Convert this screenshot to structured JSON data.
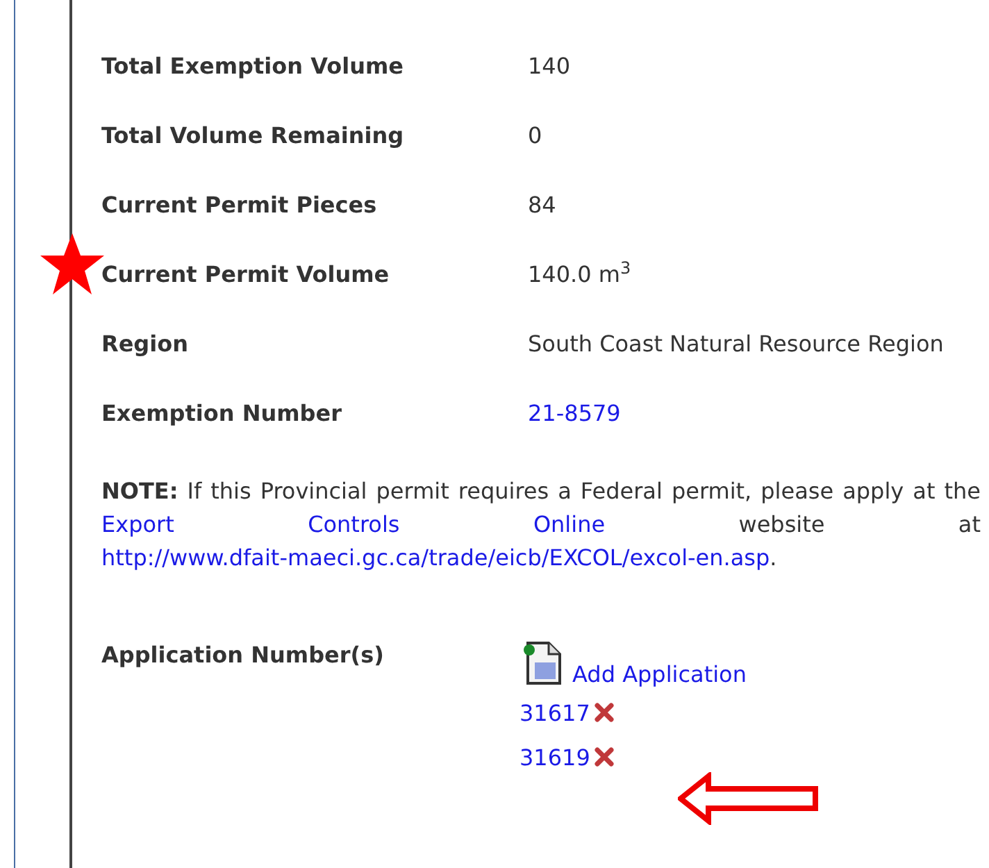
{
  "fields": [
    {
      "label": "Total Exemption Volume",
      "value": "140",
      "kind": "text"
    },
    {
      "label": "Total Volume Remaining",
      "value": "0",
      "kind": "text"
    },
    {
      "label": "Current Permit Pieces",
      "value": "84",
      "kind": "text"
    },
    {
      "label": "Current Permit Volume",
      "value": "140.0 m$^{3}$",
      "kind": "text"
    },
    {
      "label": "Region",
      "value": "South Coast Natural Resource Region",
      "kind": "text"
    },
    {
      "label": "Exemption Number",
      "value": "21-8579",
      "kind": "link"
    }
  ],
  "note": [
    {
      "kind": "bold",
      "text": "NOTE:"
    },
    {
      "kind": "text",
      "text": " If this Provincial permit requires a Federal permit, please apply at the "
    },
    {
      "kind": "link",
      "text": "Export Controls Online"
    },
    {
      "kind": "text",
      "text": " website at "
    },
    {
      "kind": "link",
      "text": "http://www.dfait-maeci.gc.ca/trade/eicb/EXCOL/excol-en.asp"
    },
    {
      "kind": "text",
      "text": "."
    }
  ],
  "applications": {
    "label": "Application Number(s)",
    "add_link": "Add Application",
    "items": [
      {
        "number": "31617"
      },
      {
        "number": "31619"
      }
    ]
  }
}
